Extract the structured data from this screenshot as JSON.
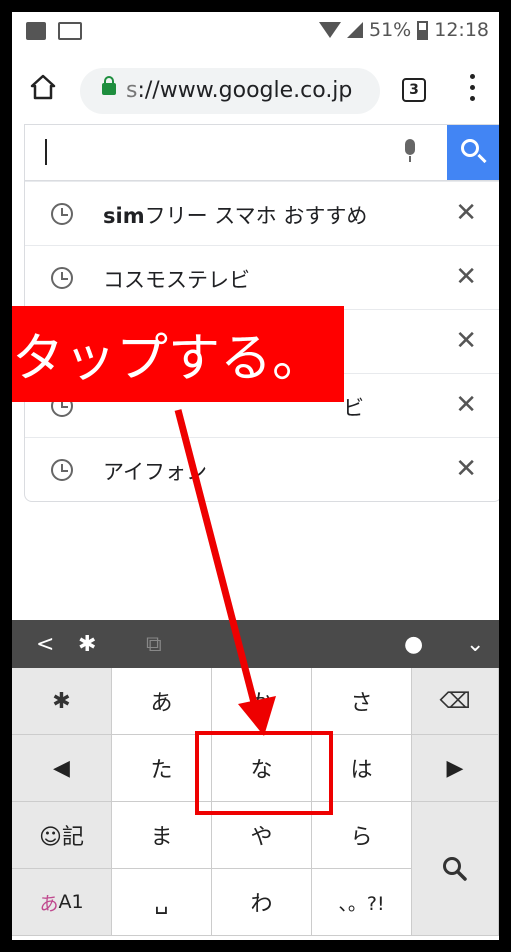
{
  "status_bar": {
    "battery": "51%",
    "time": "12:18",
    "icons": [
      "image-icon",
      "pq-icon",
      "wifi-icon",
      "signal-icon",
      "battery-icon"
    ]
  },
  "browser": {
    "url_scheme": "s",
    "url_rest": "://www.google.co.jp",
    "tab_count": "3"
  },
  "suggestions": [
    {
      "bold": "sim",
      "text": "フリー スマホ おすすめ"
    },
    {
      "bold": "",
      "text": "コスモステレビ"
    },
    {
      "bold": "",
      "text": ""
    },
    {
      "bold": "",
      "text": "ビ"
    },
    {
      "bold": "",
      "text": "アイフォン"
    }
  ],
  "callout": {
    "text": "タップする。",
    "color": "#ff0000"
  },
  "keyboard": {
    "rows": [
      [
        "gear",
        "あ",
        "か",
        "さ",
        "backspace"
      ],
      [
        "◀",
        "た",
        "な",
        "は",
        "▶"
      ],
      [
        "☺記",
        "ま",
        "や",
        "ら",
        "search"
      ],
      [
        "あA1",
        "␣",
        "わ",
        "、。?!",
        ""
      ]
    ],
    "label_left_bottom_a": "あ",
    "label_left_bottom_b": "A1",
    "emoji_label": "記",
    "space_label": "␣"
  },
  "accent": "#4285f4"
}
